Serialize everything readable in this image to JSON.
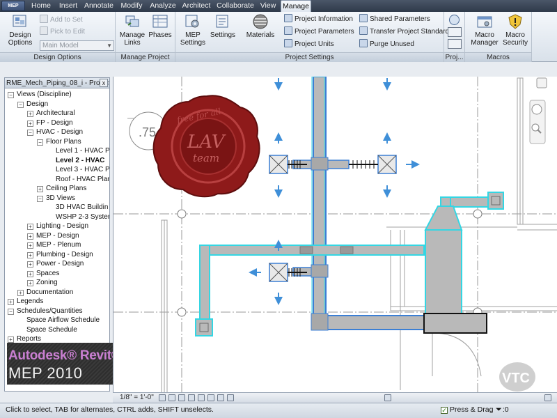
{
  "app_button": "MEP",
  "tabs": [
    {
      "label": "Home"
    },
    {
      "label": "Insert"
    },
    {
      "label": "Annotate"
    },
    {
      "label": "Modify"
    },
    {
      "label": "Analyze"
    },
    {
      "label": "Architect"
    },
    {
      "label": "Collaborate"
    },
    {
      "label": "View"
    },
    {
      "label": "Manage",
      "active": true
    }
  ],
  "ribbon": {
    "design_options": {
      "title": "Design Options",
      "big_button_line1": "Design",
      "big_button_line2": "Options",
      "add_to_set": "Add to Set",
      "pick_to_edit": "Pick to Edit",
      "main_model": "Main Model"
    },
    "manage_project": {
      "title": "Manage Project",
      "manage_links_line1": "Manage",
      "manage_links_line2": "Links",
      "phases": "Phases"
    },
    "project_settings": {
      "title": "Project Settings",
      "mep_settings_line1": "MEP",
      "mep_settings_line2": "Settings",
      "settings": "Settings",
      "materials": "Materials",
      "project_information": "Project Information",
      "project_parameters": "Project Parameters",
      "project_units": "Project Units",
      "shared_parameters": "Shared Parameters",
      "transfer_project_standards": "Transfer Project Standards",
      "purge_unused": "Purge Unused"
    },
    "project_location": {
      "title": "Proj..."
    },
    "macros": {
      "title": "Macros",
      "macro_manager_line1": "Macro",
      "macro_manager_line2": "Manager",
      "macro_security_line1": "Macro",
      "macro_security_line2": "Security"
    }
  },
  "browser": {
    "title": "RME_Mech_Piping_08_i - Project ...",
    "close": "x",
    "tree": [
      {
        "label": "Views (Discipline)",
        "level": 0,
        "toggle": "-"
      },
      {
        "label": "Design",
        "level": 1,
        "toggle": "-"
      },
      {
        "label": "Architectural",
        "level": 2,
        "toggle": "+"
      },
      {
        "label": "FP - Design",
        "level": 2,
        "toggle": "+"
      },
      {
        "label": "HVAC - Design",
        "level": 2,
        "toggle": "-"
      },
      {
        "label": "Floor Plans",
        "level": 3,
        "toggle": "-"
      },
      {
        "label": "Level 1 - HVAC P",
        "level": 4,
        "toggle": ""
      },
      {
        "label": "Level 2 - HVAC",
        "level": 4,
        "toggle": "",
        "selected": true
      },
      {
        "label": "Level 3 - HVAC P",
        "level": 4,
        "toggle": ""
      },
      {
        "label": "Roof - HVAC Plan",
        "level": 4,
        "toggle": ""
      },
      {
        "label": "Ceiling Plans",
        "level": 3,
        "toggle": "+"
      },
      {
        "label": "3D Views",
        "level": 3,
        "toggle": "-"
      },
      {
        "label": "3D HVAC Buildin",
        "level": 4,
        "toggle": ""
      },
      {
        "label": "WSHP 2-3 Syster",
        "level": 4,
        "toggle": ""
      },
      {
        "label": "Lighting - Design",
        "level": 2,
        "toggle": "+"
      },
      {
        "label": "MEP - Design",
        "level": 2,
        "toggle": "+"
      },
      {
        "label": "MEP - Plenum",
        "level": 2,
        "toggle": "+"
      },
      {
        "label": "Plumbing - Design",
        "level": 2,
        "toggle": "+"
      },
      {
        "label": "Power - Design",
        "level": 2,
        "toggle": "+"
      },
      {
        "label": "Spaces",
        "level": 2,
        "toggle": "+"
      },
      {
        "label": "Zoning",
        "level": 2,
        "toggle": "+"
      },
      {
        "label": "Documentation",
        "level": 1,
        "toggle": "+"
      },
      {
        "label": "Legends",
        "level": 0,
        "toggle": "+"
      },
      {
        "label": "Schedules/Quantities",
        "level": 0,
        "toggle": "-"
      },
      {
        "label": "Space Airflow Schedule",
        "level": 1,
        "toggle": ""
      },
      {
        "label": "Space Schedule",
        "level": 1,
        "toggle": ""
      },
      {
        "label": "Reports",
        "level": 0,
        "toggle": "+"
      }
    ]
  },
  "branding": {
    "line1": "Autodesk® Revit®",
    "line2": "MEP 2010"
  },
  "drawing": {
    "grid_bubble_label": ".75"
  },
  "watermarks": {
    "seal_text_1": "LAV",
    "seal_text_2": "team",
    "seal_ring_text": "free for all",
    "vtc_logo": "VTC"
  },
  "viewbar": {
    "scale": "1/8\" = 1'-0\""
  },
  "status": {
    "hint": "Click to select, TAB for alternates, CTRL adds, SHIFT unselects.",
    "press_drag": "Press & Drag",
    "filter_count": ":0"
  },
  "colors": {
    "duct_fill": "#b9b9b9",
    "duct_selected_outline": "#34d6e3",
    "duct_selected_inner": "#3c7fd4",
    "air_terminal_arrows": "#3f8fd8",
    "wax_seal": "#8e1a1a"
  }
}
